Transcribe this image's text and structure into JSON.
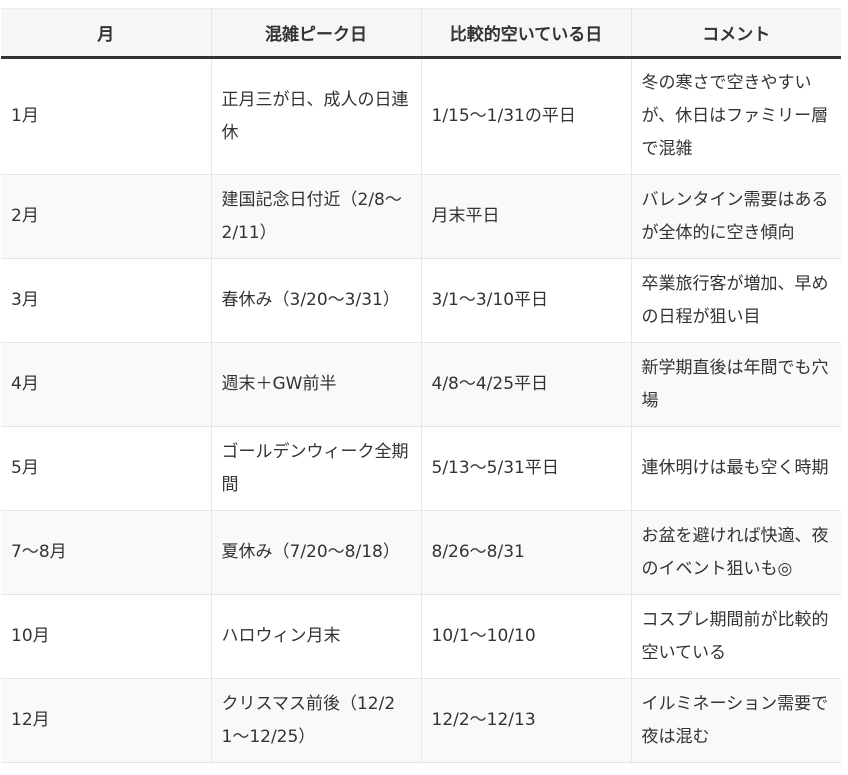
{
  "table": {
    "headers": [
      "月",
      "混雑ピーク日",
      "比較的空いている日",
      "コメント"
    ],
    "rows": [
      [
        "1月",
        "正月三が日、成人の日連休",
        "1/15〜1/31の平日",
        "冬の寒さで空きやすいが、休日はファミリー層で混雑"
      ],
      [
        "2月",
        "建国記念日付近（2/8〜2/11）",
        "月末平日",
        "バレンタイン需要はあるが全体的に空き傾向"
      ],
      [
        "3月",
        "春休み（3/20〜3/31）",
        "3/1〜3/10平日",
        "卒業旅行客が増加、早めの日程が狙い目"
      ],
      [
        "4月",
        "週末＋GW前半",
        "4/8〜4/25平日",
        "新学期直後は年間でも穴場"
      ],
      [
        "5月",
        "ゴールデンウィーク全期間",
        "5/13〜5/31平日",
        "連休明けは最も空く時期"
      ],
      [
        "7〜8月",
        "夏休み（7/20〜8/18）",
        "8/26〜8/31",
        "お盆を避ければ快適、夜のイベント狙いも◎"
      ],
      [
        "10月",
        "ハロウィン月末",
        "10/1〜10/10",
        "コスプレ期間前が比較的空いている"
      ],
      [
        "12月",
        "クリスマス前後（12/21〜12/25）",
        "12/2〜12/13",
        "イルミネーション需要で夜は混む"
      ]
    ]
  }
}
